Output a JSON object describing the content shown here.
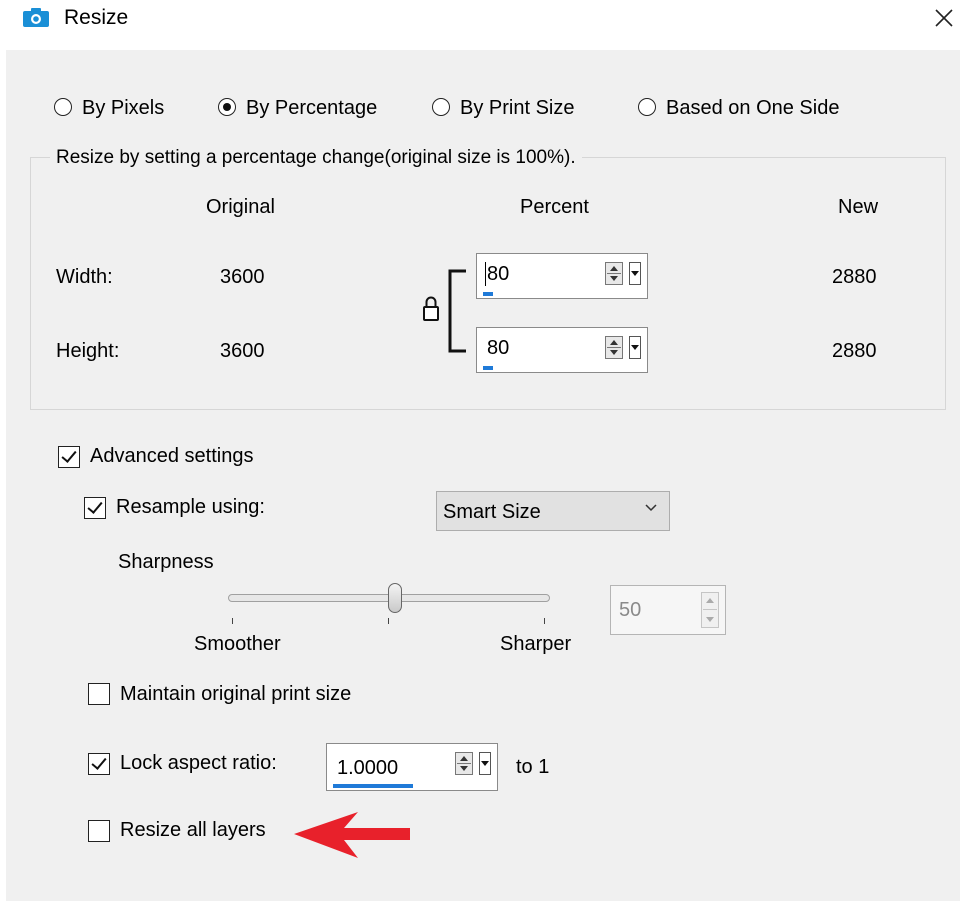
{
  "window": {
    "title": "Resize",
    "close_label": "close"
  },
  "modes": [
    {
      "label": "By Pixels",
      "selected": false
    },
    {
      "label": "By Percentage",
      "selected": true
    },
    {
      "label": "By Print Size",
      "selected": false
    },
    {
      "label": "Based on One Side",
      "selected": false
    }
  ],
  "group": {
    "caption": "Resize by setting a percentage change(original size is 100%).",
    "headers": {
      "original": "Original",
      "percent": "Percent",
      "new": "New"
    },
    "rows": [
      {
        "label": "Width:",
        "original": "3600",
        "percent": "80",
        "new": "2880"
      },
      {
        "label": "Height:",
        "original": "3600",
        "percent": "80",
        "new": "2880"
      }
    ]
  },
  "advanced": {
    "label": "Advanced settings",
    "checked": true
  },
  "resample": {
    "label": "Resample using:",
    "checked": true,
    "method": "Smart Size"
  },
  "sharpness": {
    "label": "Sharpness",
    "min_label": "Smoother",
    "max_label": "Sharper",
    "value": "50",
    "level_percent": 50
  },
  "maintain_print": {
    "label": "Maintain original print size",
    "checked": false
  },
  "lock_aspect": {
    "label": "Lock aspect ratio:",
    "checked": true,
    "value": "1.0000",
    "suffix": "to 1"
  },
  "resize_layers": {
    "label": "Resize all layers",
    "checked": false
  },
  "colors": {
    "accent": "#1f7ad8",
    "arrow": "#e8212b",
    "icon": "#1a8fd6"
  }
}
